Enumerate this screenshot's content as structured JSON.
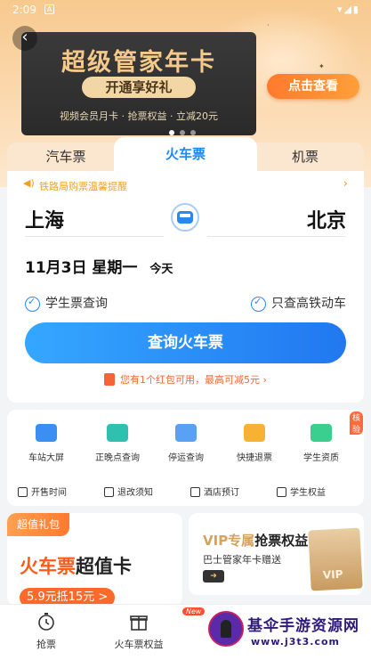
{
  "status_bar": {
    "time": "2:09",
    "notification": "A"
  },
  "banner": {
    "title": "超级管家年卡",
    "pill": "开通享好礼",
    "subtitle": "视频会员月卡 · 抢票权益 · 立减20元",
    "cta": "点击查看"
  },
  "tabs": [
    "汽车票",
    "火车票",
    "机票"
  ],
  "notice": "铁路局购票温馨提醒",
  "from_city": "上海",
  "to_city": "北京",
  "date": {
    "date": "11月3日",
    "weekday": "星期一",
    "today": "今天"
  },
  "options": {
    "student": "学生票查询",
    "high_speed": "只查高铁动车"
  },
  "query_button": "查询火车票",
  "redpacket": "您有1个红包可用，最高可减5元 ›",
  "services": [
    {
      "label": "车站大屏",
      "color": "#3b8ff3"
    },
    {
      "label": "正晚点查询",
      "color": "#30c0b0"
    },
    {
      "label": "停运查询",
      "color": "#5aa0f5"
    },
    {
      "label": "快捷退票",
      "color": "#f7b233"
    },
    {
      "label": "学生资质",
      "color": "#3bcf8f",
      "badge": "核验"
    }
  ],
  "sub_services": [
    "开售时间",
    "退改须知",
    "酒店预订",
    "学生权益"
  ],
  "promo_left": {
    "tag": "超值礼包",
    "title_a": "火车票",
    "title_b": "超值卡",
    "price": "5.9元抵15元 >"
  },
  "promo_right": {
    "title_a": "VIP专属",
    "title_b": "抢票权益",
    "sub": "巴士管家年卡赠送",
    "box": "VIP"
  },
  "bottom_nav": [
    {
      "label": "抢票"
    },
    {
      "label": "火车票权益",
      "badge": "New"
    }
  ],
  "watermark": {
    "title": "基伞手游资源网",
    "url": "www.j3t3.com"
  }
}
